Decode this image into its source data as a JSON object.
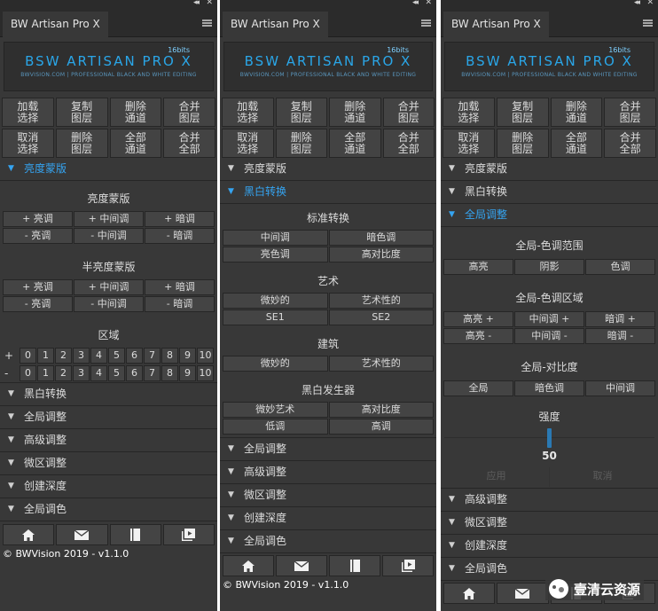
{
  "panel_title": "BW Artisan Pro X",
  "logo": {
    "badge": "16bits",
    "main_text": "BSW ARTISAN PRO X",
    "sub_text": "BWVISION.COM | PROFESSIONAL BLACK AND WHITE EDITING"
  },
  "main_buttons": [
    "加载\n选择",
    "复制\n图层",
    "删除\n通道",
    "合并\n图层",
    "取消\n选择",
    "删除\n图层",
    "全部\n通道",
    "合并\n全部"
  ],
  "sections": {
    "brightness_mask": "亮度蒙版",
    "bw_convert": "黑白转换",
    "global_adjust": "全局调整",
    "advanced_adjust": "高级调整",
    "micro_adjust": "微区调整",
    "create_depth": "创建深度",
    "global_tone": "全局调色"
  },
  "panel1": {
    "mask_title": "亮度蒙版",
    "mask_row1": [
      "+ 亮调",
      "+ 中间调",
      "+ 暗调"
    ],
    "mask_row2": [
      "- 亮调",
      "- 中间调",
      "- 暗调"
    ],
    "half_mask_title": "半亮度蒙版",
    "half_row1": [
      "+ 亮调",
      "+ 中间调",
      "+ 暗调"
    ],
    "half_row2": [
      "- 亮调",
      "- 中间调",
      "- 暗调"
    ],
    "zone_title": "区域",
    "zone_plus": "+",
    "zone_minus": "-",
    "zones": [
      "0",
      "1",
      "2",
      "3",
      "4",
      "5",
      "6",
      "7",
      "8",
      "9",
      "10"
    ]
  },
  "panel2": {
    "standard_title": "标准转换",
    "standard_row1": [
      "中间调",
      "暗色调"
    ],
    "standard_row2": [
      "亮色调",
      "高对比度"
    ],
    "art_title": "艺术",
    "art_row1": [
      "微妙的",
      "艺术性的"
    ],
    "art_row2": [
      "SE1",
      "SE2"
    ],
    "arch_title": "建筑",
    "arch_row1": [
      "微妙的",
      "艺术性的"
    ],
    "gen_title": "黑白发生器",
    "gen_row1": [
      "微妙艺术",
      "高对比度"
    ],
    "gen_row2": [
      "低调",
      "高调"
    ]
  },
  "panel3": {
    "range_title": "全局-色调范围",
    "range_row": [
      "高亮",
      "阴影",
      "色调"
    ],
    "zone_title": "全局-色调区域",
    "zone_row1": [
      "高亮 +",
      "中间调 +",
      "暗调 +"
    ],
    "zone_row2": [
      "高亮 -",
      "中间调 -",
      "暗调 -"
    ],
    "contrast_title": "全局-对比度",
    "contrast_row": [
      "全局",
      "暗色调",
      "中间调"
    ],
    "strength_title": "强度",
    "strength_value": "50",
    "strength_level": 0.5,
    "apply_label": "应用",
    "cancel_label": "取消"
  },
  "copyright": "© BWVision 2019 - v1.1.0",
  "watermark": "壹清云资源",
  "colors": {
    "panel_bg": "#383838",
    "accent": "#35a4f1"
  }
}
